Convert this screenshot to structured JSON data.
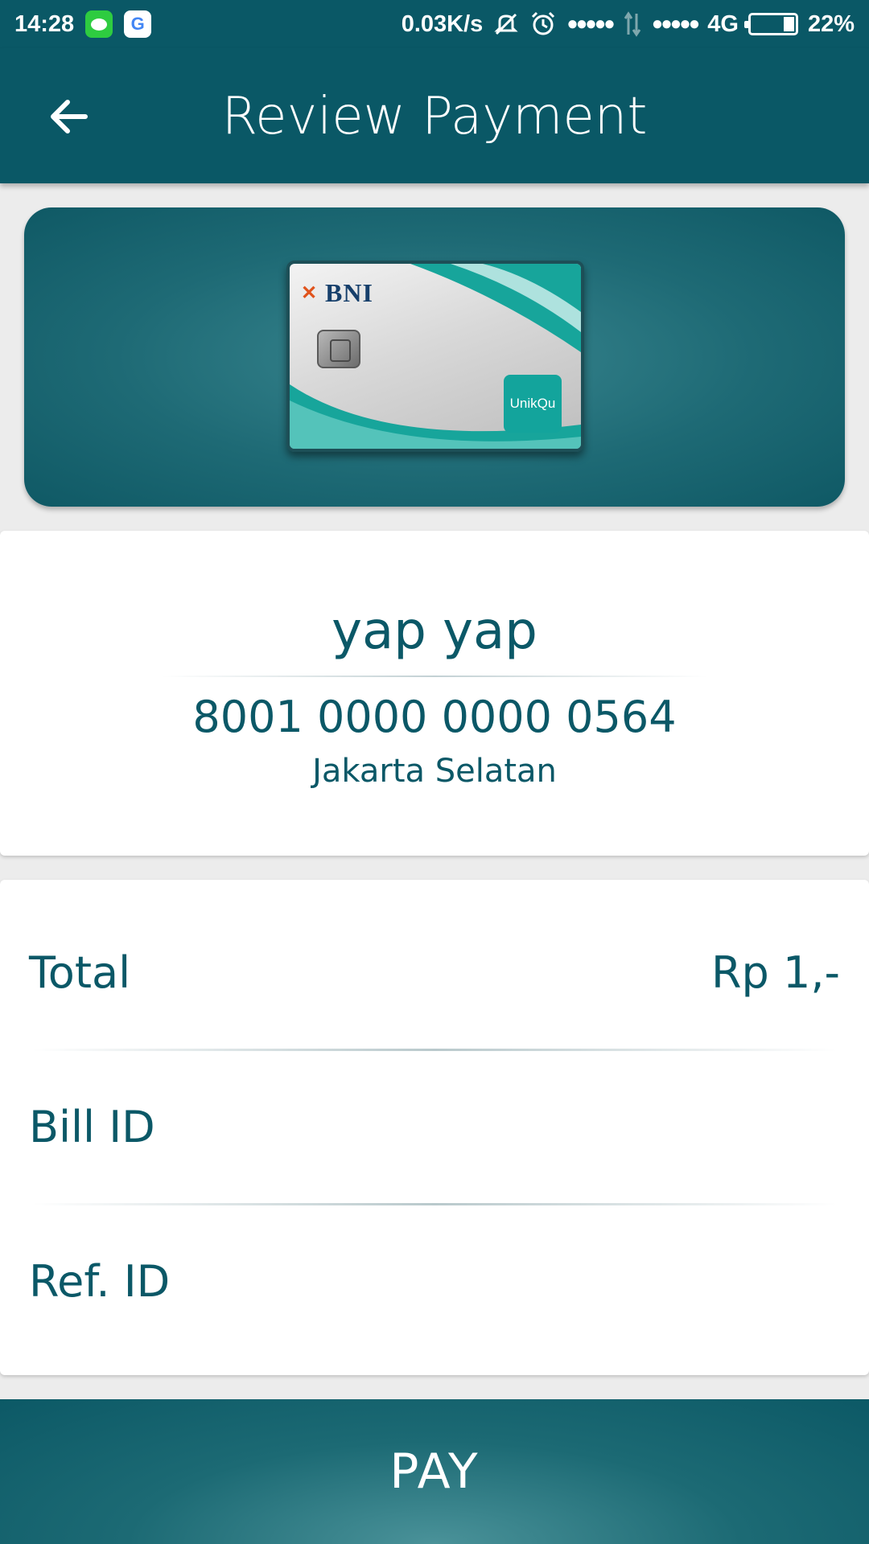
{
  "status_bar": {
    "time": "14:28",
    "network_speed": "0.03K/s",
    "signal_dots_1": "●●●●●",
    "signal_dots_2": "●●●●●",
    "network_type": "4G",
    "battery_percent": "22%",
    "battery_level": 0.22,
    "icons": [
      "message-icon",
      "google-icon",
      "vibrate-icon",
      "alarm-icon",
      "data-transfer-icon",
      "battery-icon"
    ]
  },
  "app_bar": {
    "title": "Review Payment",
    "back_icon": "arrow-left-icon"
  },
  "card": {
    "bank_name": "BNI",
    "product_name": "UnikQu"
  },
  "account": {
    "name": "yap yap",
    "number": "8001 0000 0000 0564",
    "location": "Jakarta Selatan"
  },
  "details": {
    "rows": [
      {
        "label": "Total",
        "value": "Rp 1,-"
      },
      {
        "label": "Bill ID",
        "value": ""
      },
      {
        "label": "Ref. ID",
        "value": ""
      }
    ]
  },
  "pay_button": {
    "label": "PAY"
  },
  "colors": {
    "primary": "#0a5866",
    "text": "#0b5867",
    "background": "#ececec",
    "card_accent": "#13a49c",
    "bni_orange": "#e0531c"
  }
}
